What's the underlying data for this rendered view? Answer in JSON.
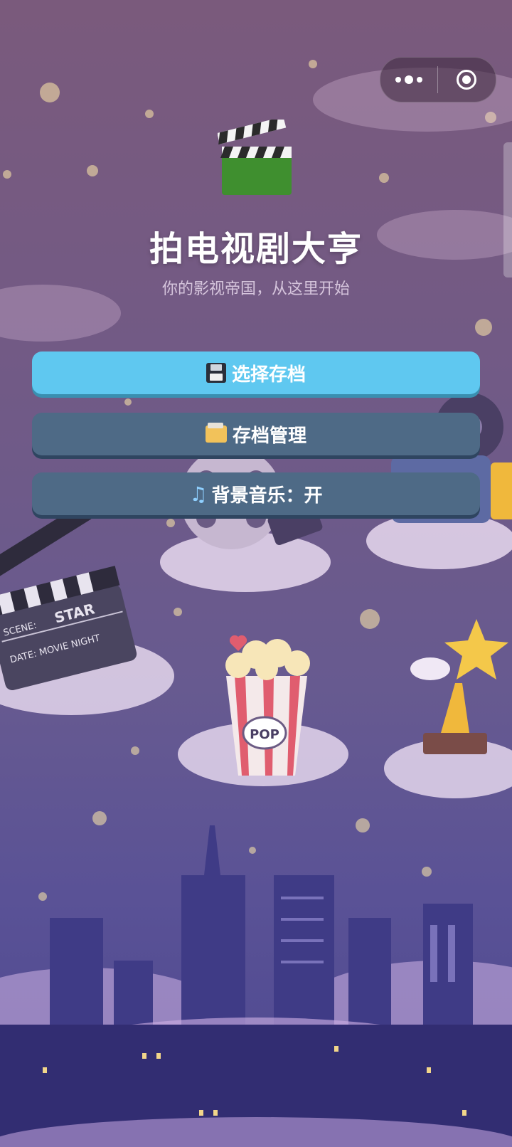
{
  "app": {
    "title": "拍电视剧大亨",
    "subtitle": "你的影视帝国，从这里开始"
  },
  "buttons": {
    "select_save": "选择存档",
    "manage_save": "存档管理",
    "music_toggle": "背景音乐：开"
  },
  "background_signs": {
    "clapper_scene": "SCENE:",
    "clapper_star": "STAR",
    "clapper_date": "DATE: MOVIE NIGHT",
    "popcorn": "POP"
  },
  "icons": [
    "more-icon",
    "close-target-icon",
    "clapperboard-logo-icon",
    "floppy-disk-icon",
    "folder-icon",
    "music-note-icon"
  ],
  "colors": {
    "primary_button": "#5fc8f0",
    "secondary_button": "#4e6a86",
    "background_top": "#7a5a7c",
    "background_bottom": "#4c4790"
  }
}
